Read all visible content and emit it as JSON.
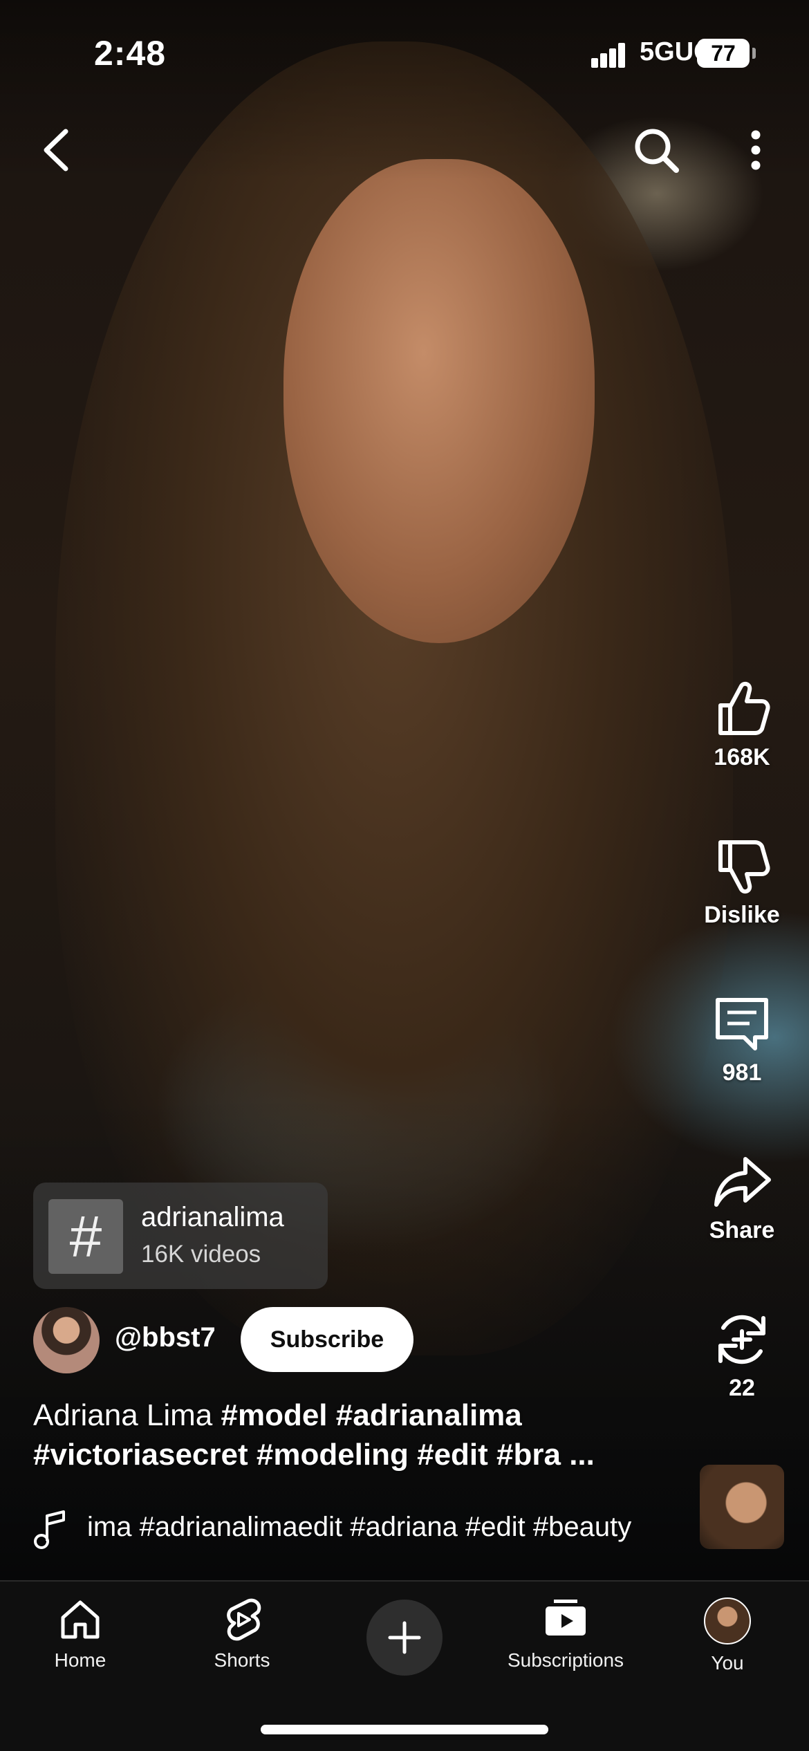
{
  "status_bar": {
    "time": "2:48",
    "network": "5GUC",
    "battery": "77"
  },
  "toolbar": {
    "back_icon": "chevron-left-icon",
    "search_icon": "search-icon",
    "more_icon": "more-vertical-icon"
  },
  "actions": {
    "like_count": "168K",
    "dislike_label": "Dislike",
    "comment_count": "981",
    "share_label": "Share",
    "remix_count": "22"
  },
  "hashtag": {
    "name": "adrianalima",
    "count": "16K videos"
  },
  "channel": {
    "handle": "@bbst7",
    "subscribe_label": "Subscribe"
  },
  "caption": {
    "title": "Adriana Lima ",
    "tags_line1": "#model #adrianalima",
    "tags_line2": "#victoriasecret #modeling #edit #bra ..."
  },
  "music": {
    "text": "ima #adrianalimaedit #adriana #edit #beauty"
  },
  "nav": {
    "home": "Home",
    "shorts": "Shorts",
    "subscriptions": "Subscriptions",
    "you": "You"
  },
  "colors": {
    "nav_background": "#0f0f0f",
    "subscribe_bg": "#ffffff",
    "subscribe_text": "#0f0f0f"
  }
}
